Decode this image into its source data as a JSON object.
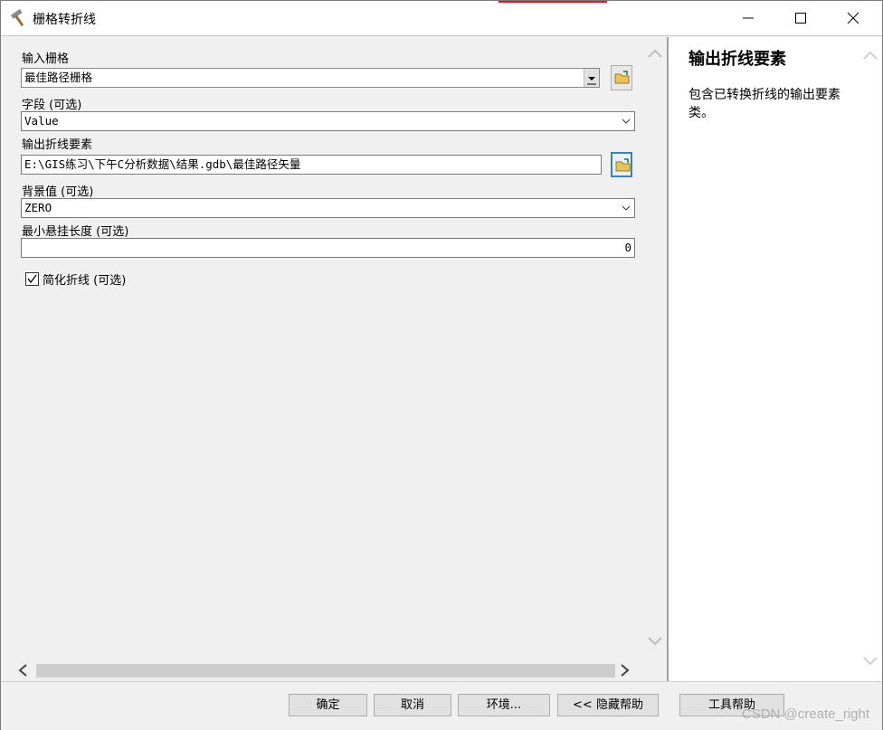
{
  "window": {
    "title": "栅格转折线"
  },
  "form": {
    "input_raster": {
      "label": "输入栅格",
      "value": "最佳路径栅格"
    },
    "field": {
      "label": "字段 (可选)",
      "value": "Value"
    },
    "output_features": {
      "label": "输出折线要素",
      "value": "E:\\GIS练习\\下午C分析数据\\结果.gdb\\最佳路径矢量"
    },
    "background": {
      "label": "背景值 (可选)",
      "value": "ZERO"
    },
    "min_dangle": {
      "label": "最小悬挂长度 (可选)",
      "value": "0"
    },
    "simplify": {
      "label": "简化折线 (可选)",
      "checked": true
    }
  },
  "help": {
    "title": "输出折线要素",
    "text": "包含已转换折线的输出要素类。"
  },
  "buttons": {
    "ok": "确定",
    "cancel": "取消",
    "env": "环境...",
    "hide_help": "<< 隐藏帮助",
    "tool_help": "工具帮助"
  },
  "watermark": "CSDN @create_right"
}
